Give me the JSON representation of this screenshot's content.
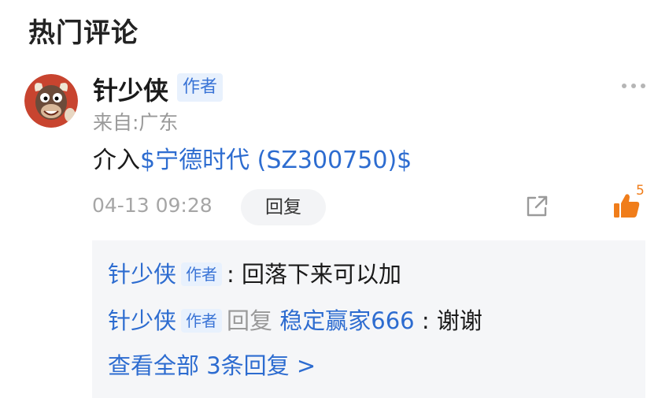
{
  "section": {
    "title": "热门评论"
  },
  "comment": {
    "author": "针少侠",
    "author_badge": "作者",
    "location": "来自:广东",
    "content_prefix": "介入",
    "stock_link": "$宁德时代 (SZ300750)$",
    "timestamp": "04-13 09:28",
    "reply_label": "回复",
    "like_count": "5"
  },
  "replies": [
    {
      "author": "针少侠",
      "badge": "作者",
      "separator": ":",
      "text": "回落下来可以加"
    },
    {
      "author": "针少侠",
      "badge": "作者",
      "reply_word": "回复",
      "target": "稳定赢家666",
      "separator": ":",
      "text": "谢谢"
    }
  ],
  "view_all": "查看全部 3条回复 >",
  "colors": {
    "link": "#2d6cd0",
    "like": "#f07d1a",
    "badge_bg": "#e8f1fd"
  },
  "icons": {
    "more": "more-dots-icon",
    "share": "share-icon",
    "like": "thumbs-up-icon"
  }
}
